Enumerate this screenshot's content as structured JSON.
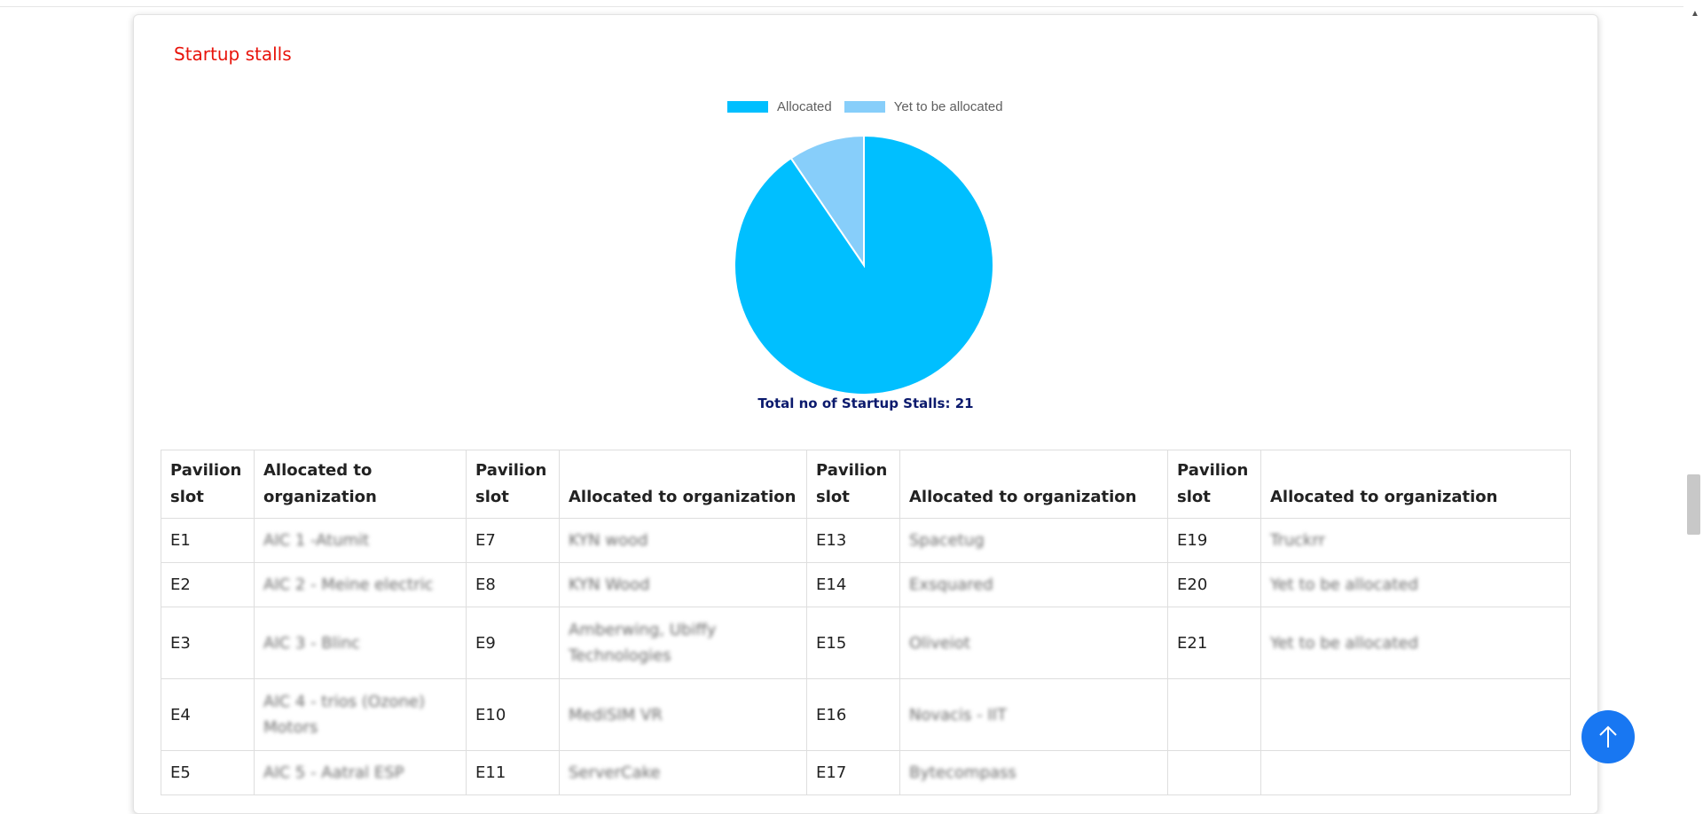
{
  "card": {
    "title": "Startup stalls"
  },
  "chart_data": {
    "type": "pie",
    "title": "",
    "categories": [
      "Allocated",
      "Yet to be allocated"
    ],
    "values": [
      19,
      2
    ],
    "colors": [
      "#00bfff",
      "#87cefa"
    ],
    "legend": "top",
    "caption": "Total no of Startup Stalls: 21"
  },
  "table": {
    "headers": [
      "Pavilion slot",
      "Allocated to organization",
      "Pavilion slot",
      "Allocated to organization",
      "Pavilion slot",
      "Allocated to organization",
      "Pavilion slot",
      "Allocated to organization"
    ],
    "rows": [
      [
        "E1",
        "AIC 1 -Atumit",
        "E7",
        "KYN wood",
        "E13",
        "Spacetug",
        "E19",
        "Truckrr"
      ],
      [
        "E2",
        "AIC 2 - Meine electric",
        "E8",
        "KYN Wood",
        "E14",
        "Exsquared",
        "E20",
        "Yet to be allocated"
      ],
      [
        "E3",
        "AIC 3 - Blinc",
        "E9",
        "Amberwing, Ubiffy Technologies",
        "E15",
        "Oliveiot",
        "E21",
        "Yet to be allocated"
      ],
      [
        "E4",
        "AIC 4 - trios (Ozone) Motors",
        "E10",
        "MediSIM VR",
        "E16",
        "Novacis - IIT",
        "",
        ""
      ],
      [
        "E5",
        "AIC 5 - Aatral ESP",
        "E11",
        "ServerCake",
        "E17",
        "Bytecompass",
        "",
        ""
      ]
    ]
  },
  "icons": {
    "back_to_top": "arrow-up-icon",
    "scroll_up": "triangle-up-icon"
  }
}
